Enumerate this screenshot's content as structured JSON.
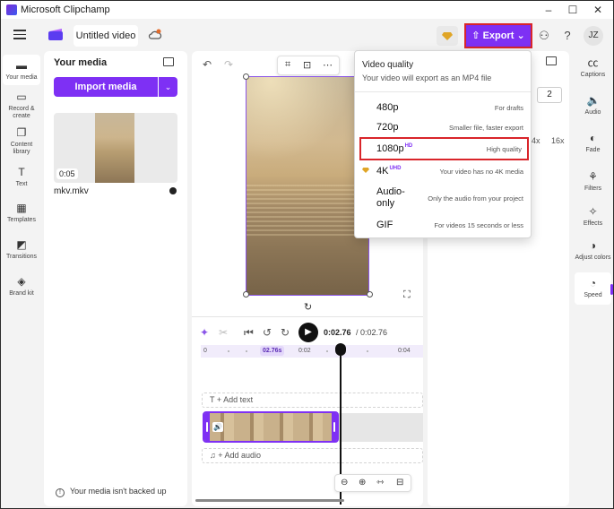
{
  "window": {
    "title": "Microsoft Clipchamp"
  },
  "header": {
    "project_title": "Untitled video",
    "export_label": "Export",
    "avatar_initials": "JZ"
  },
  "left_nav": {
    "items": [
      {
        "label": "Your media",
        "icon": "folder-icon"
      },
      {
        "label": "Record & create",
        "icon": "camera-icon"
      },
      {
        "label": "Content library",
        "icon": "library-icon"
      },
      {
        "label": "Text",
        "icon": "text-icon"
      },
      {
        "label": "Templates",
        "icon": "templates-icon"
      },
      {
        "label": "Transitions",
        "icon": "transitions-icon"
      },
      {
        "label": "Brand kit",
        "icon": "brand-kit-icon"
      }
    ]
  },
  "media_panel": {
    "title": "Your media",
    "import_label": "Import media",
    "file": {
      "duration": "0:05",
      "name": "mkv.mkv"
    },
    "backup_text": "Your media isn't backed up"
  },
  "timeline": {
    "current_time": "0:02.76",
    "total_time": "/ 0:02.76",
    "ruler_labels": [
      "0",
      "0:02",
      "0:04"
    ],
    "playhead_label": "02.76s",
    "add_text": "+ Add text",
    "add_audio": "+ Add audio"
  },
  "props": {
    "speed_value": "2",
    "speed_labels": [
      "4x",
      "16x"
    ]
  },
  "right_nav": {
    "items": [
      {
        "label": "Captions",
        "icon": "captions-icon"
      },
      {
        "label": "Audio",
        "icon": "audio-icon"
      },
      {
        "label": "Fade",
        "icon": "fade-icon"
      },
      {
        "label": "Filters",
        "icon": "filters-icon"
      },
      {
        "label": "Effects",
        "icon": "effects-icon"
      },
      {
        "label": "Adjust colors",
        "icon": "adjust-colors-icon"
      },
      {
        "label": "Speed",
        "icon": "speed-icon"
      }
    ]
  },
  "export_menu": {
    "title": "Video quality",
    "subtitle": "Your video will export as an MP4 file",
    "options": [
      {
        "label": "480p",
        "badge": "",
        "desc": "For drafts"
      },
      {
        "label": "720p",
        "badge": "",
        "desc": "Smaller file, faster export"
      },
      {
        "label": "1080p",
        "badge": "HD",
        "desc": "High quality"
      },
      {
        "label": "4K",
        "badge": "UHD",
        "desc": "Your video has no 4K media"
      },
      {
        "label": "Audio-only",
        "badge": "",
        "desc": "Only the audio from your project"
      },
      {
        "label": "GIF",
        "badge": "",
        "desc": "For videos 15 seconds or less"
      }
    ]
  },
  "colors": {
    "accent": "#7e30f4",
    "highlight_border": "#d9252a"
  }
}
